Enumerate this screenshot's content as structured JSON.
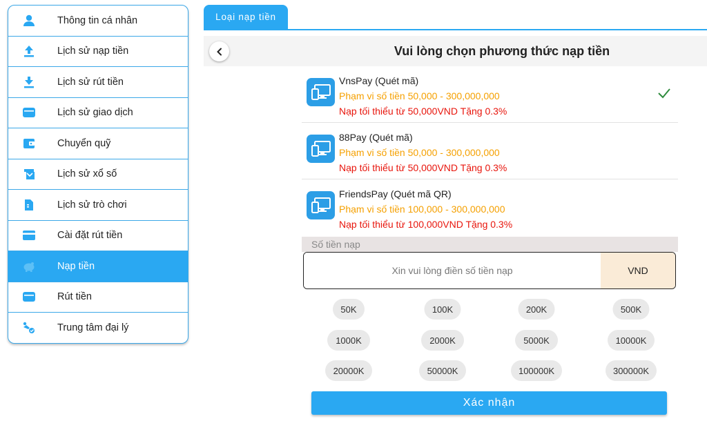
{
  "sidebar": {
    "items": [
      {
        "label": "Thông tin cá nhân",
        "icon": "user-icon"
      },
      {
        "label": "Lịch sử nạp tiền",
        "icon": "upload-icon"
      },
      {
        "label": "Lịch sử rút tiền",
        "icon": "download-icon"
      },
      {
        "label": "Lịch sử giao dịch",
        "icon": "card-icon"
      },
      {
        "label": "Chuyển quỹ",
        "icon": "wallet-icon"
      },
      {
        "label": "Lịch sử xổ số",
        "icon": "lottery-icon"
      },
      {
        "label": "Lịch sử trò chơi",
        "icon": "document-icon"
      },
      {
        "label": "Cài đặt rút tiền",
        "icon": "credit-card-icon"
      },
      {
        "label": "Nạp tiền",
        "icon": "piggy-bank-icon",
        "active": true
      },
      {
        "label": "Rút tiền",
        "icon": "card-icon"
      },
      {
        "label": "Trung tâm đại lý",
        "icon": "agent-icon"
      }
    ]
  },
  "tab": {
    "label": "Loại nạp tiền"
  },
  "header": {
    "title": "Vui lòng chọn phương thức nạp tiền"
  },
  "methods": [
    {
      "name": "VnsPay (Quét mã)",
      "range": "Phạm vi số tiền 50,000 - 300,000,000",
      "min": "Nạp tối thiểu từ 50,000VND Tặng 0.3%",
      "selected": true
    },
    {
      "name": "88Pay (Quét mã)",
      "range": "Phạm vi số tiền 50,000 - 300,000,000",
      "min": "Nạp tối thiểu từ 50,000VND Tặng 0.3%",
      "selected": false
    },
    {
      "name": "FriendsPay (Quét mã QR)",
      "range": "Phạm vi số tiền 100,000 - 300,000,000",
      "min": "Nạp tối thiểu từ 100,000VND Tặng 0.3%",
      "selected": false
    }
  ],
  "amount": {
    "label": "Số tiền nạp",
    "placeholder": "Xin vui lòng điền số tiền nạp",
    "unit": "VND"
  },
  "chips": [
    [
      "50K",
      "100K",
      "200K",
      "500K"
    ],
    [
      "1000K",
      "2000K",
      "5000K",
      "10000K"
    ],
    [
      "20000K",
      "50000K",
      "100000K",
      "300000K"
    ]
  ],
  "confirm_label": "Xác nhận",
  "colors": {
    "accent": "#2aa8f2",
    "range": "#f5a000",
    "minimum": "#e8150c",
    "check": "#2e8b3d"
  }
}
